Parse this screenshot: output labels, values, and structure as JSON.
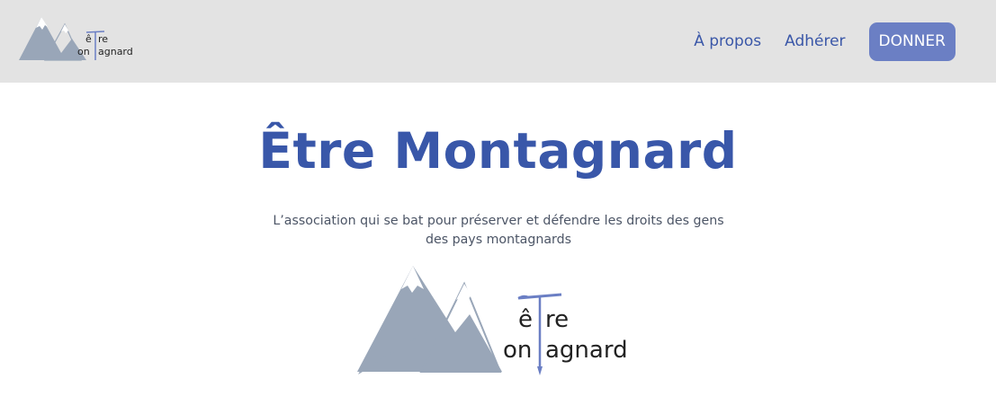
{
  "navbar": {
    "logo": {
      "line1": "être",
      "line2": "montagnard",
      "line1_shown": "ê  re",
      "line2_shown": "on  agnard"
    },
    "links": [
      {
        "label": "À propos"
      },
      {
        "label": "Adhérer"
      }
    ],
    "donate_label": "DONNER"
  },
  "hero": {
    "title": "Être Montagnard",
    "subtitle": "L’association qui se bat pour préserver et défendre les droits des gens des pays montagnards"
  },
  "colors": {
    "navbar_bg": "#e3e3e3",
    "accent": "#3957a9",
    "button": "#6b7fc4",
    "mountain": "#99a6b8",
    "subtitle": "#4c5566"
  },
  "icons": {
    "logo": "mountain-ice-axe-logo"
  }
}
